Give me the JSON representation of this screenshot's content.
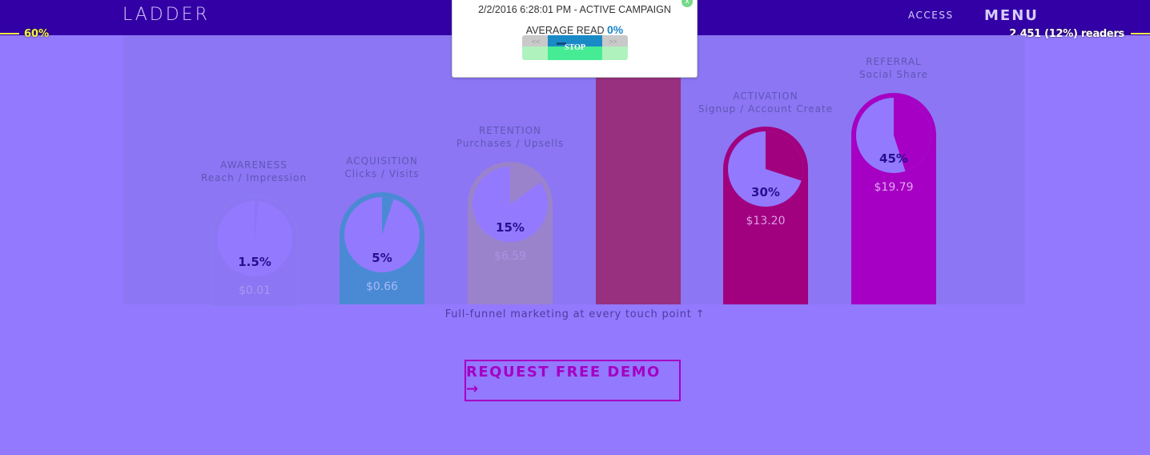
{
  "header": {
    "logo": "LADDER",
    "nav": {
      "access": "ACCESS",
      "menu": "MENU"
    }
  },
  "scroll_indicator": {
    "percent_label": "60%",
    "readers_label": "2,451 (12%) readers"
  },
  "popup": {
    "title": "2/2/2016 6:28:01 PM - ACTIVE CAMPAIGN",
    "average_read_label": "AVERAGE READ",
    "average_read_value": "0%",
    "controls": {
      "back": "<<",
      "stop": "STOP",
      "forward": ">>"
    },
    "close": "x"
  },
  "funnel": {
    "columns": [
      {
        "name": "AWARENESS",
        "sub": "Reach / Impression",
        "percent_label": "1.5%",
        "percent": 0.015,
        "money": "$0.01",
        "color": "#8c76f3"
      },
      {
        "name": "ACQUISITION",
        "sub": "Clicks / Visits",
        "percent_label": "5%",
        "percent": 0.05,
        "money": "$0.66",
        "color": "#4a8ad4"
      },
      {
        "name": "RETENTION",
        "sub": "Purchases / Upsells",
        "percent_label": "15%",
        "percent": 0.15,
        "money": "$6.59",
        "color": "#9b83cc"
      },
      {
        "name": "",
        "sub": "",
        "percent_label": "",
        "percent": null,
        "money": "",
        "color": "#98307f"
      },
      {
        "name": "ACTIVATION",
        "sub": "Signup / Account Create",
        "percent_label": "30%",
        "percent": 0.3,
        "money": "$13.20",
        "color": "#a1007f"
      },
      {
        "name": "REFERRAL",
        "sub": "Social Share",
        "percent_label": "45%",
        "percent": 0.45,
        "money": "$19.79",
        "color": "#a500c3"
      }
    ],
    "caption": "Full-funnel marketing at every touch point ↑"
  },
  "cta": {
    "label": "REQUEST FREE DEMO →"
  },
  "colors": {
    "background": "#9379fe",
    "topbar": "#3300a6",
    "accent": "#a500c3",
    "scroll_yellow": "#f4f246"
  }
}
